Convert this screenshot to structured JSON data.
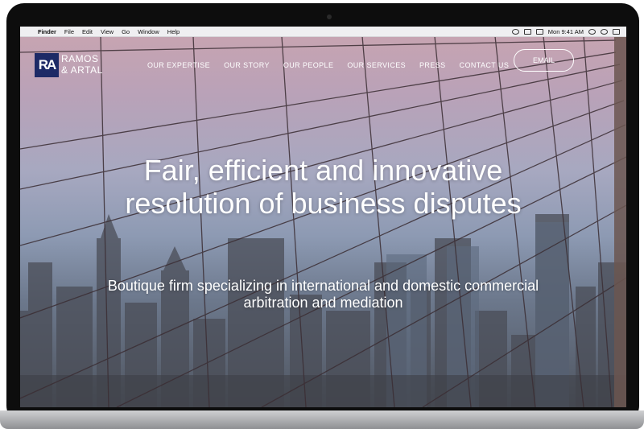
{
  "menubar": {
    "items": [
      "Finder",
      "File",
      "Edit",
      "View",
      "Go",
      "Window",
      "Help"
    ],
    "clock": "Mon 9:41 AM"
  },
  "logo": {
    "mark": "RA",
    "line1": "RAMOS",
    "line2": "& ARTAL",
    "brand_color": "#1d2a66"
  },
  "nav": {
    "items": [
      "OUR EXPERTISE",
      "OUR STORY",
      "OUR PEOPLE",
      "OUR SERVICES",
      "PRESS",
      "CONTACT US"
    ],
    "email_label": "EMAIL"
  },
  "hero": {
    "title": "Fair, efficient and innovative resolution of business disputes",
    "subtitle": "Boutique firm specializing in international and domestic commercial arbitration and mediation"
  }
}
